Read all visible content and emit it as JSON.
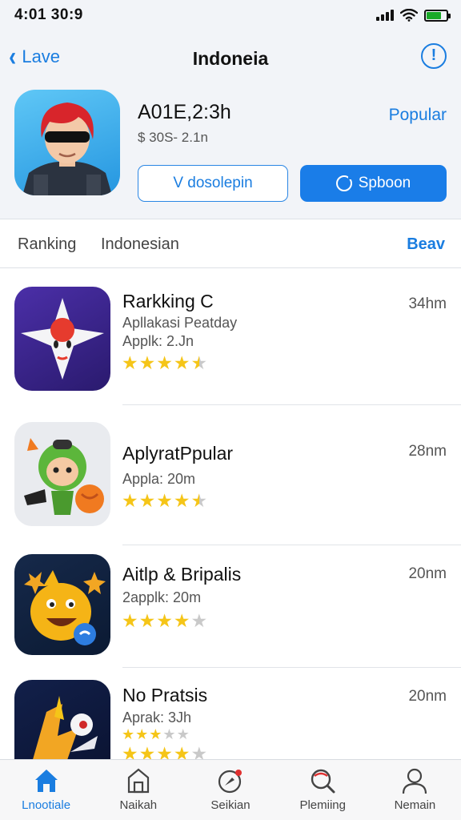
{
  "status_bar": {
    "time": "4:01 30:9"
  },
  "nav": {
    "back_label": "Lave",
    "title": "Indoneia",
    "info_icon": "info-icon"
  },
  "hero": {
    "name": "A01E,2:3h",
    "price": "$ 30S- 2.1n",
    "popular_label": "Popular",
    "btn_outline": "V dosolepin",
    "btn_primary": "Spboon"
  },
  "filters": {
    "item1": "Ranking",
    "item2": "Indonesian",
    "right": "Beav"
  },
  "apps": [
    {
      "name": "Rarkking C",
      "sub1": "Apllakasi Peatday",
      "sub2": "Applk: 2.Jn",
      "size": "34hm",
      "rating": 4.5
    },
    {
      "name": "AplyratPpular",
      "sub1": "Appla: 20m",
      "size": "28nm",
      "rating": 4.5
    },
    {
      "name": "Aitlp & Bripalis",
      "sub1": "2applk: 20m",
      "size": "20nm",
      "rating": 4
    },
    {
      "name": "No Pratsis",
      "sub1": "Aprak: 3Jh",
      "size": "20nm",
      "rating": 3
    }
  ],
  "tabs": [
    {
      "label": "Lnootiale",
      "icon": "home-icon",
      "active": true
    },
    {
      "label": "Naikah",
      "icon": "bag-icon",
      "active": false
    },
    {
      "label": "Seikian",
      "icon": "compass-icon",
      "active": false
    },
    {
      "label": "Plemiing",
      "icon": "search-icon",
      "active": false
    },
    {
      "label": "Nemain",
      "icon": "person-icon",
      "active": false
    }
  ],
  "colors": {
    "accent": "#1a7de8",
    "star": "#f5c518"
  }
}
